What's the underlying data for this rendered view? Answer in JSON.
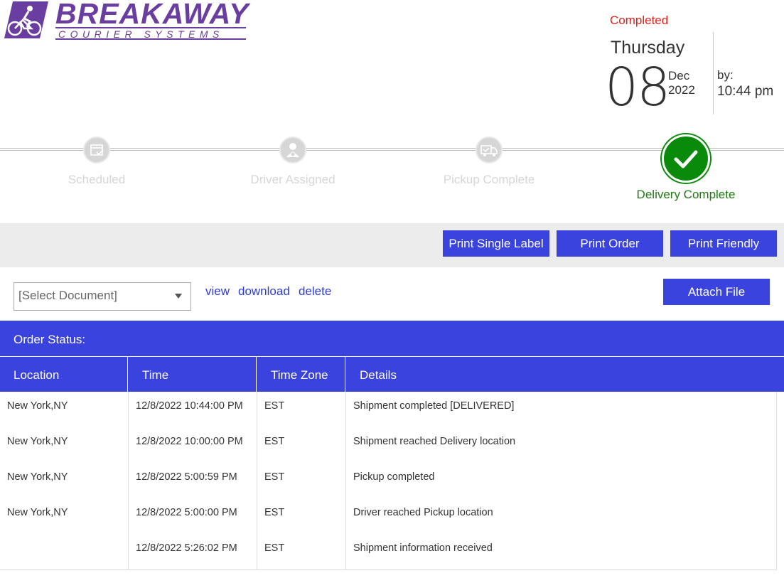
{
  "brand": {
    "name": "BREAKAWAY",
    "tagline": "COURIER SYSTEMS",
    "color": "#6a3ea1"
  },
  "status": {
    "label": "Completed",
    "day_name": "Thursday",
    "day": "08",
    "month": "Dec",
    "year": "2022",
    "by_label": "by:",
    "by_time": "10:44 pm"
  },
  "progress": {
    "steps": [
      {
        "label": "Scheduled",
        "icon": "calendar-check-icon",
        "state": "inactive"
      },
      {
        "label": "Driver Assigned",
        "icon": "driver-icon",
        "state": "inactive"
      },
      {
        "label": "Pickup Complete",
        "icon": "truck-check-icon",
        "state": "inactive"
      },
      {
        "label": "Delivery Complete",
        "icon": "check-circle-icon",
        "state": "complete"
      }
    ],
    "active_color": "#0a8a0a"
  },
  "toolbar": {
    "print_single_label": "Print Single Label",
    "print_order": "Print Order",
    "print_friendly": "Print Friendly"
  },
  "documents": {
    "select_value": "[Select Document]",
    "view": "view",
    "download": "download",
    "delete": "delete",
    "attach": "Attach File"
  },
  "order_status": {
    "title": "Order Status:",
    "columns": [
      "Location",
      "Time",
      "Time Zone",
      "Details"
    ],
    "rows": [
      {
        "location": "New York,NY",
        "time": "12/8/2022 10:44:00 PM",
        "tz": "EST",
        "details": "Shipment completed [DELIVERED]"
      },
      {
        "location": "New York,NY",
        "time": "12/8/2022 10:00:00 PM",
        "tz": "EST",
        "details": "Shipment reached Delivery location"
      },
      {
        "location": "New York,NY",
        "time": "12/8/2022 5:00:59 PM",
        "tz": "EST",
        "details": "Pickup completed"
      },
      {
        "location": "New York,NY",
        "time": "12/8/2022 5:00:00 PM",
        "tz": "EST",
        "details": "Driver reached Pickup location"
      },
      {
        "location": "",
        "time": "12/8/2022 5:26:02 PM",
        "tz": "EST",
        "details": "Shipment information received"
      }
    ]
  },
  "colors": {
    "primary": "#3a43dd",
    "status_red": "#e0211b",
    "success": "#0a8a0a"
  }
}
